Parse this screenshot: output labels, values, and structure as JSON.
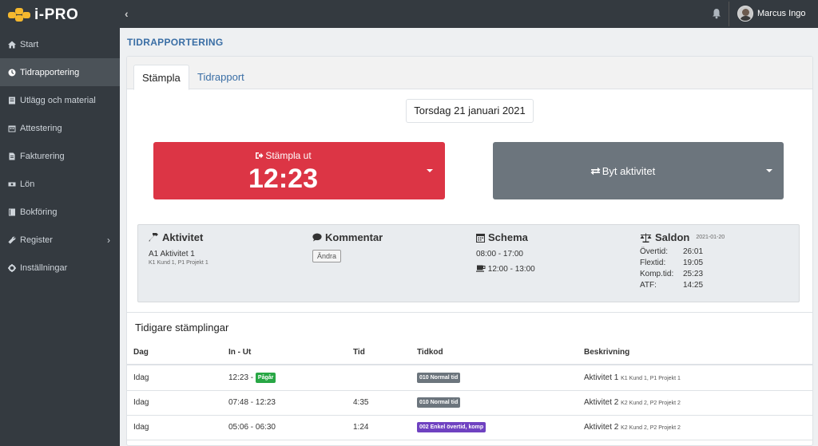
{
  "header": {
    "app_name": "i-PRO",
    "collapse_glyph": "‹",
    "user_name": "Marcus Ingo"
  },
  "sidebar": {
    "items": [
      {
        "label": "Start",
        "icon": "home-icon"
      },
      {
        "label": "Tidrapportering",
        "icon": "clock-icon",
        "active": true
      },
      {
        "label": "Utlägg och material",
        "icon": "receipt-icon"
      },
      {
        "label": "Attestering",
        "icon": "calendar-icon"
      },
      {
        "label": "Fakturering",
        "icon": "file-icon"
      },
      {
        "label": "Lön",
        "icon": "money-icon"
      },
      {
        "label": "Bokföring",
        "icon": "book-icon"
      },
      {
        "label": "Register",
        "icon": "wrench-icon",
        "chevron": "›"
      },
      {
        "label": "Inställningar",
        "icon": "gear-icon"
      }
    ]
  },
  "page": {
    "title": "TIDRAPPORTERING"
  },
  "tabs": {
    "stampla": "Stämpla",
    "tidrapport": "Tidrapport"
  },
  "date_label": "Torsdag 21 januari 2021",
  "stamp": {
    "label": "Stämpla ut",
    "time": "12:23"
  },
  "switch": {
    "label": "Byt aktivitet"
  },
  "info": {
    "aktivitet": {
      "title": "Aktivitet",
      "name": "A1 Aktivitet 1",
      "sub": "K1 Kund 1, P1 Projekt 1"
    },
    "kommentar": {
      "title": "Kommentar",
      "edit": "Ändra"
    },
    "schema": {
      "title": "Schema",
      "work": "08:00 - 17:00",
      "break": "12:00 - 13:00"
    },
    "saldon": {
      "title": "Saldon",
      "date": "2021-01-20",
      "rows": [
        {
          "k": "Övertid:",
          "v": "26:01"
        },
        {
          "k": "Flextid:",
          "v": "19:05"
        },
        {
          "k": "Komp.tid:",
          "v": "25:23"
        },
        {
          "k": "ATF:",
          "v": "14:25"
        }
      ]
    }
  },
  "history": {
    "title": "Tidigare stämplingar",
    "columns": [
      "Dag",
      "In - Ut",
      "Tid",
      "Tidkod",
      "Beskrivning"
    ],
    "rows": [
      {
        "dag": "Idag",
        "inut": "12:23 -",
        "badge_inut": "Pågår",
        "tid": "",
        "tidkod": "010 Normal tid",
        "tidkod_color": "#6c757d",
        "desc": "Aktivitet 1",
        "desc_sub": "K1 Kund 1, P1 Projekt 1"
      },
      {
        "dag": "Idag",
        "inut": "07:48 - 12:23",
        "badge_inut": "",
        "tid": "4:35",
        "tidkod": "010 Normal tid",
        "tidkod_color": "#6c757d",
        "desc": "Aktivitet 2",
        "desc_sub": "K2 Kund 2, P2 Projekt 2"
      },
      {
        "dag": "Idag",
        "inut": "05:06 - 06:30",
        "badge_inut": "",
        "tid": "1:24",
        "tidkod": "002 Enkel övertid, komp",
        "tidkod_color": "#6f42c1",
        "desc": "Aktivitet 2",
        "desc_sub": "K2 Kund 2, P2 Projekt 2"
      }
    ]
  }
}
